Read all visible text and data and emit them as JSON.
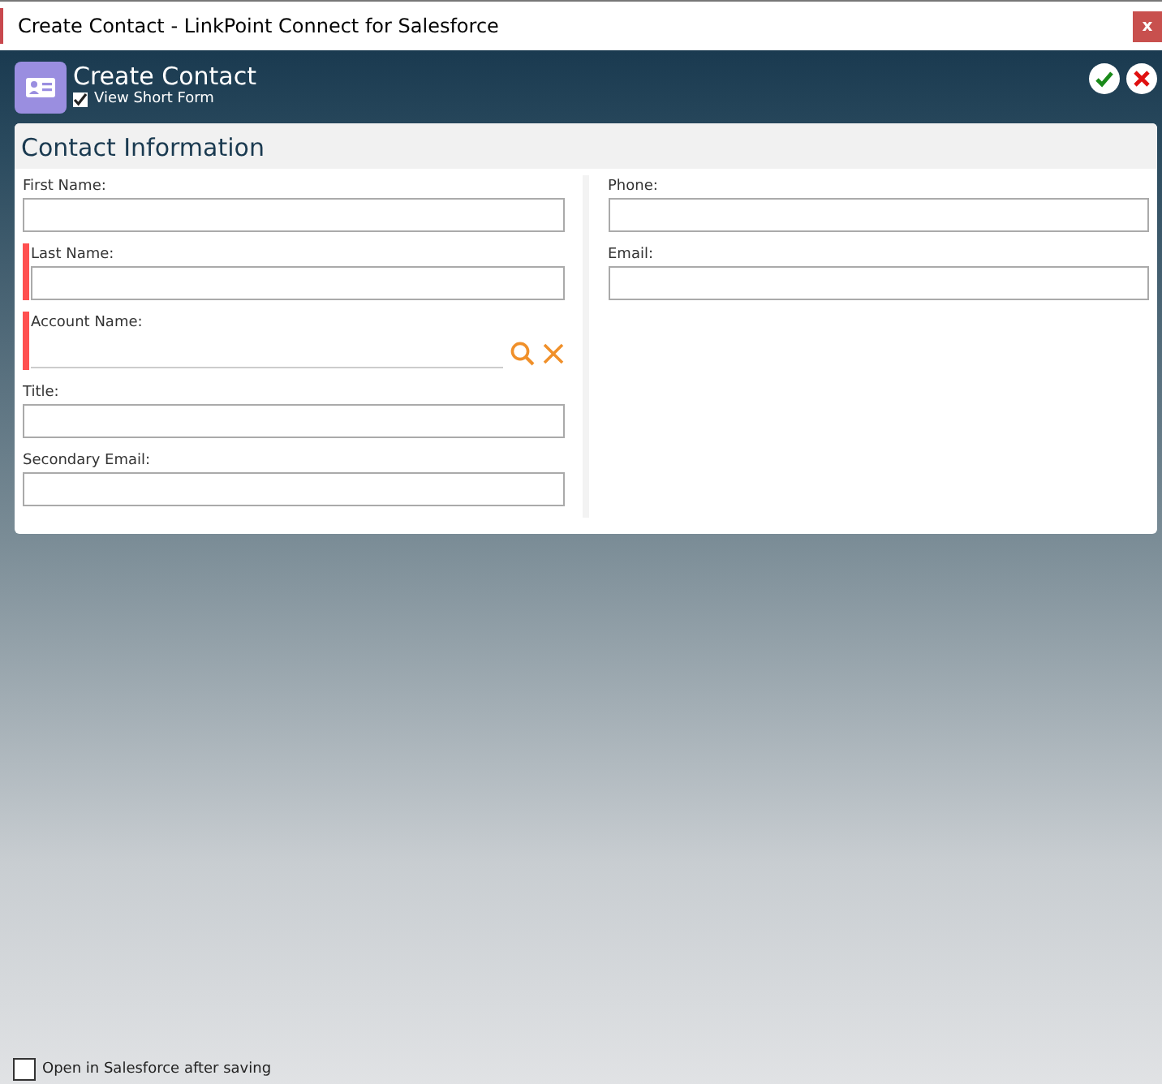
{
  "window": {
    "title": "Create Contact - LinkPoint Connect for Salesforce",
    "close": "x"
  },
  "header": {
    "title": "Create Contact",
    "short_form": {
      "label": "View Short Form",
      "checked": true
    }
  },
  "section": {
    "title": "Contact Information",
    "columns": [
      [
        {
          "label": "First Name:",
          "kind": "text",
          "required": false
        },
        {
          "label": "Last Name:",
          "kind": "text",
          "required": true
        },
        {
          "label": "Account Name:",
          "kind": "lookup",
          "required": true
        },
        {
          "label": "Title:",
          "kind": "text",
          "required": false
        },
        {
          "label": "Secondary Email:",
          "kind": "text",
          "required": false
        }
      ],
      [
        {
          "label": "Phone:",
          "kind": "text",
          "required": false
        },
        {
          "label": "Email:",
          "kind": "text",
          "required": false
        }
      ]
    ]
  },
  "footer": {
    "open_after_saving": {
      "label": "Open in Salesforce after saving",
      "checked": false
    }
  }
}
